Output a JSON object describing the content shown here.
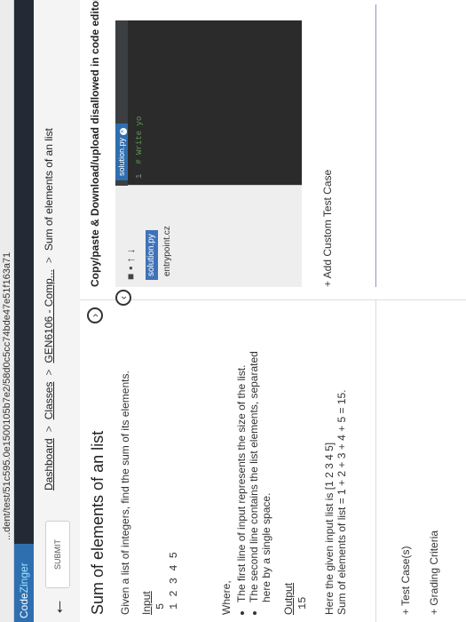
{
  "browser": {
    "url_fragment": "...dent/test/51c595.0e1500105b7e2/58d0c5cc74bde47e51f163a71"
  },
  "app": {
    "brand_prefix": "Code",
    "brand_suffix": "Zinger"
  },
  "toolbar": {
    "submit_label": "SUBMIT",
    "breadcrumbs": [
      {
        "label": "Dashboard"
      },
      {
        "label": "Classes"
      },
      {
        "label": "GEN6106 - Comp..."
      },
      {
        "label": "Sum of elements of an list"
      }
    ],
    "separator": ">"
  },
  "problem": {
    "title": "Sum of elements of an list",
    "description": "Given a list of integers, find the sum of its elements.",
    "input_heading": "Input",
    "input_lines": [
      "5",
      "1 2 3 4 5"
    ],
    "where_label": "Where,",
    "where_items": [
      "The first line of input represents the size of the list.",
      "The second line contains the list elements, separated here by a single space."
    ],
    "output_heading": "Output",
    "output_value": "15",
    "explanation_line1": "Here the given input list is [1 2 3 4 5]",
    "explanation_line2": "Sum of elements of list = 1 + 2 + 3 + 4 + 5 = 15.",
    "test_cases_label": "+ Test Case(s)",
    "grading_criteria_label": "+ Grading Criteria"
  },
  "editor": {
    "notice": "Copy/paste & Download/upload disallowed in code editor",
    "files": [
      "solution.py",
      "entrypoint.cz"
    ],
    "active_tab": "solution.py",
    "first_line_number": "1",
    "first_line_code": "# Write yo",
    "add_custom_test_case": "+ Add Custom Test Case"
  },
  "icons": [
    "back-arrow-icon",
    "collapse-circle-icon",
    "expand-circle-icon",
    "new-file-icon",
    "new-folder-icon",
    "upload-icon",
    "download-icon",
    "tab-close-icon"
  ],
  "colors": {
    "brand": "#2f6fb0",
    "topbar": "#232a36",
    "editor_bg": "#2b2b2b",
    "active_file": "#3f72b8"
  }
}
